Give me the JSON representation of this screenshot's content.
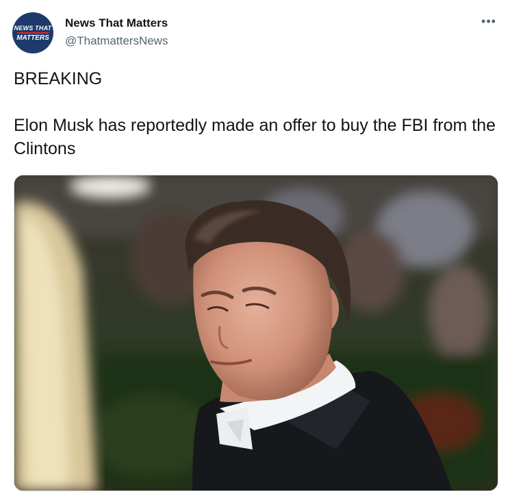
{
  "account": {
    "name": "News That Matters",
    "handle": "@ThatmattersNews",
    "avatar_line1": "NEWS THAT",
    "avatar_line2": "MATTERS"
  },
  "tweet": {
    "text": "BREAKING\n\nElon Musk has reportedly made an offer to buy the FBI from the Clintons"
  },
  "more_menu": {
    "glyph": "•••"
  },
  "icons": {
    "more": "more-horizontal-icon"
  },
  "colors": {
    "text": "#0f1419",
    "secondary": "#536471",
    "border": "#cfd9de",
    "avatar_bg": "#1d3a6b",
    "avatar_bar": "#d62b2b"
  }
}
